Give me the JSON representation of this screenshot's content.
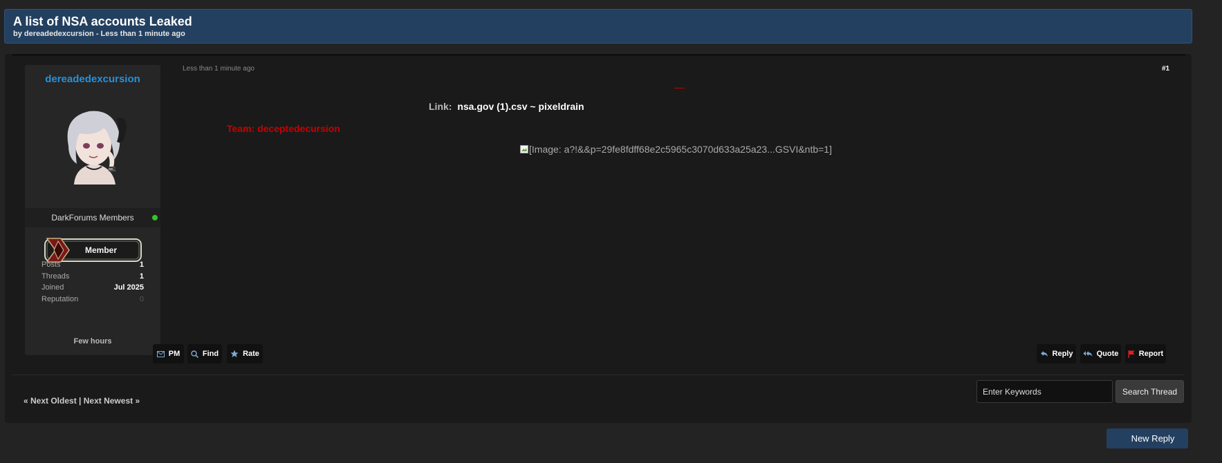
{
  "thread": {
    "title": "A list of NSA accounts Leaked",
    "subtitle": "by dereadedexcursion - Less than 1 minute ago"
  },
  "author": {
    "username": "dereadedexcursion",
    "group": "DarkForums Members",
    "badge_text": "Member",
    "online": true,
    "stats": [
      {
        "label": "Posts",
        "value": "1"
      },
      {
        "label": "Threads",
        "value": "1"
      },
      {
        "label": "Joined",
        "value": "Jul 2025"
      },
      {
        "label": "Reputation",
        "value": "0"
      }
    ],
    "footer": "Few hours"
  },
  "post": {
    "date": "Less than 1 minute ago",
    "number": "#1",
    "link_label": "Link:",
    "link_value": "nsa.gov (1).csv ~ pixeldrain",
    "team_line": "Team: deceptedecursion",
    "broken_image_alt": "[Image: a?!&&p=29fe8fdff68e2c5965c3070d633a25a23...GSVI&ntb=1]"
  },
  "actions": {
    "left": [
      {
        "label": "PM",
        "icon": "envelope-icon"
      },
      {
        "label": "Find",
        "icon": "search-icon"
      },
      {
        "label": "Rate",
        "icon": "star-icon"
      }
    ],
    "right": [
      {
        "label": "Reply",
        "icon": "reply-icon"
      },
      {
        "label": "Quote",
        "icon": "quote-icon"
      },
      {
        "label": "Report",
        "icon": "flag-icon"
      }
    ]
  },
  "nav": {
    "prev": "« Next Oldest",
    "separator": "|",
    "next": "Next Newest »"
  },
  "search": {
    "placeholder": "Enter Keywords",
    "button_label": "Search Thread"
  },
  "new_reply_label": "New Reply",
  "colors": {
    "header_bg": "#234060",
    "username": "#2a8fd8",
    "team_red": "#c80000",
    "online_green": "#34c42c"
  }
}
